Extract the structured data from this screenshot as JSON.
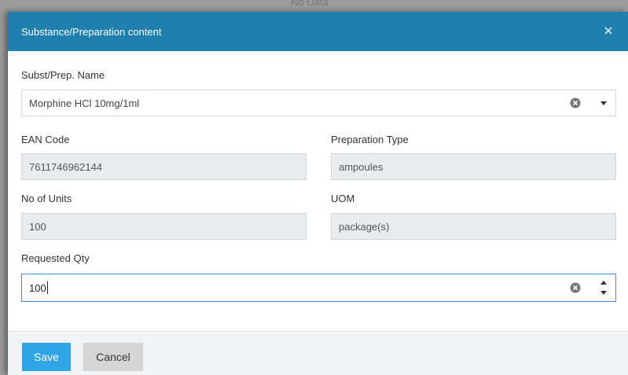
{
  "backdrop": {
    "text": "No Data"
  },
  "dialog": {
    "title": "Substance/Preparation content",
    "close_icon": "close-icon"
  },
  "form": {
    "subst_name": {
      "label": "Subst/Prep. Name",
      "value": "Morphine HCl 10mg/1ml"
    },
    "ean_code": {
      "label": "EAN Code",
      "value": "7611746962144"
    },
    "preparation_type": {
      "label": "Preparation Type",
      "value": "ampoules"
    },
    "no_of_units": {
      "label": "No of Units",
      "value": "100"
    },
    "uom": {
      "label": "UOM",
      "value": "package(s)"
    },
    "requested_qty": {
      "label": "Requested Qty",
      "value": "100"
    }
  },
  "footer": {
    "save_label": "Save",
    "cancel_label": "Cancel"
  },
  "colors": {
    "header": "#1f7fae",
    "save_button": "#2fa4e7",
    "cancel_button": "#d6d6d6",
    "readonly_field": "#e9ebed",
    "focus_border": "#3d8fd9"
  }
}
